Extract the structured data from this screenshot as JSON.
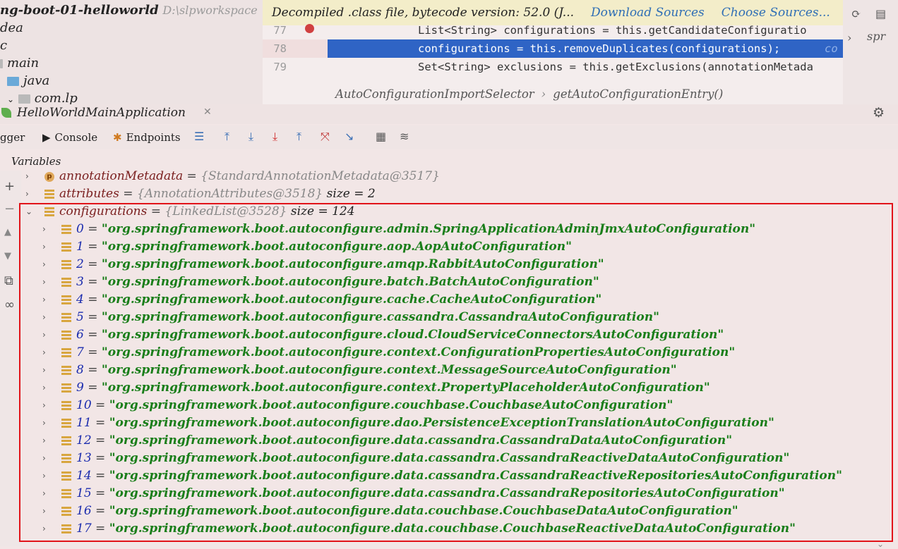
{
  "project": {
    "name": "ng-boot-01-helloworld",
    "path": "D:\\slpworkspace",
    "items": [
      {
        "label": "dea"
      },
      {
        "label": "c"
      },
      {
        "label": "main"
      },
      {
        "label": "java"
      },
      {
        "label": "com.lp"
      }
    ]
  },
  "editor": {
    "banner": {
      "message": "Decompiled .class file, bytecode version: 52.0 (J...",
      "download": "Download Sources",
      "choose": "Choose Sources..."
    },
    "lines": [
      {
        "num": "77",
        "text": "List<String> configurations = this.getCandidateConfiguratio"
      },
      {
        "num": "78",
        "text": "configurations = this.removeDuplicates(configurations);",
        "tail": "co"
      },
      {
        "num": "79",
        "text": "Set<String> exclusions = this.getExclusions(annotationMetada"
      }
    ],
    "breadcrumb": [
      "AutoConfigurationImportSelector",
      "getAutoConfigurationEntry()"
    ],
    "right_tab": "spr"
  },
  "debug": {
    "config_name": "HelloWorldMainApplication",
    "tabs": [
      {
        "label": "gger"
      },
      {
        "label": "Console"
      },
      {
        "label": "Endpoints"
      }
    ],
    "panel_title": "Variables",
    "variables": [
      {
        "name": "annotationMetadata",
        "value": "{StandardAnnotationMetadata@3517}",
        "icon": "p"
      },
      {
        "name": "attributes",
        "value": "{AnnotationAttributes@3518}",
        "size": "size = 2",
        "icon": "list"
      },
      {
        "name": "configurations",
        "value": "{LinkedList@3528}",
        "size": "size = 124",
        "icon": "list"
      }
    ],
    "entries": [
      {
        "i": "0",
        "v": "\"org.springframework.boot.autoconfigure.admin.SpringApplicationAdminJmxAutoConfiguration\""
      },
      {
        "i": "1",
        "v": "\"org.springframework.boot.autoconfigure.aop.AopAutoConfiguration\""
      },
      {
        "i": "2",
        "v": "\"org.springframework.boot.autoconfigure.amqp.RabbitAutoConfiguration\""
      },
      {
        "i": "3",
        "v": "\"org.springframework.boot.autoconfigure.batch.BatchAutoConfiguration\""
      },
      {
        "i": "4",
        "v": "\"org.springframework.boot.autoconfigure.cache.CacheAutoConfiguration\""
      },
      {
        "i": "5",
        "v": "\"org.springframework.boot.autoconfigure.cassandra.CassandraAutoConfiguration\""
      },
      {
        "i": "6",
        "v": "\"org.springframework.boot.autoconfigure.cloud.CloudServiceConnectorsAutoConfiguration\""
      },
      {
        "i": "7",
        "v": "\"org.springframework.boot.autoconfigure.context.ConfigurationPropertiesAutoConfiguration\""
      },
      {
        "i": "8",
        "v": "\"org.springframework.boot.autoconfigure.context.MessageSourceAutoConfiguration\""
      },
      {
        "i": "9",
        "v": "\"org.springframework.boot.autoconfigure.context.PropertyPlaceholderAutoConfiguration\""
      },
      {
        "i": "10",
        "v": "\"org.springframework.boot.autoconfigure.couchbase.CouchbaseAutoConfiguration\""
      },
      {
        "i": "11",
        "v": "\"org.springframework.boot.autoconfigure.dao.PersistenceExceptionTranslationAutoConfiguration\""
      },
      {
        "i": "12",
        "v": "\"org.springframework.boot.autoconfigure.data.cassandra.CassandraDataAutoConfiguration\""
      },
      {
        "i": "13",
        "v": "\"org.springframework.boot.autoconfigure.data.cassandra.CassandraReactiveDataAutoConfiguration\""
      },
      {
        "i": "14",
        "v": "\"org.springframework.boot.autoconfigure.data.cassandra.CassandraReactiveRepositoriesAutoConfiguration\""
      },
      {
        "i": "15",
        "v": "\"org.springframework.boot.autoconfigure.data.cassandra.CassandraRepositoriesAutoConfiguration\""
      },
      {
        "i": "16",
        "v": "\"org.springframework.boot.autoconfigure.data.couchbase.CouchbaseDataAutoConfiguration\""
      },
      {
        "i": "17",
        "v": "\"org.springframework.boot.autoconfigure.data.couchbase.CouchbaseReactiveDataAutoConfiguration\""
      }
    ]
  },
  "colors": {
    "highlight_box": "#e1141a",
    "string_value": "#1a7e1a",
    "index": "#1b2cae",
    "selection": "#2f64c5"
  }
}
